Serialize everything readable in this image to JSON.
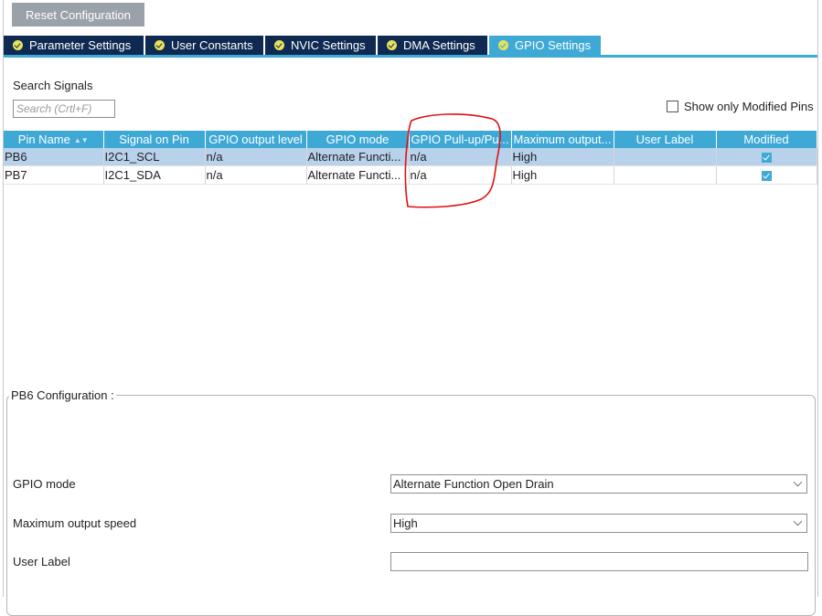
{
  "toolbar": {
    "reset_label": "Reset Configuration"
  },
  "tabs": [
    {
      "label": "Parameter Settings",
      "active": false
    },
    {
      "label": "User Constants",
      "active": false
    },
    {
      "label": "NVIC Settings",
      "active": false
    },
    {
      "label": "DMA Settings",
      "active": false
    },
    {
      "label": "GPIO Settings",
      "active": true
    }
  ],
  "search": {
    "label": "Search Signals",
    "placeholder": "Search (Crtl+F)"
  },
  "show_modified": {
    "label": "Show only Modified Pins",
    "checked": false
  },
  "table": {
    "columns": [
      "Pin Name",
      "Signal on Pin",
      "GPIO output level",
      "GPIO mode",
      "GPIO Pull-up/Pu...",
      "Maximum output...",
      "User Label",
      "Modified"
    ],
    "rows": [
      {
        "pin": "PB6",
        "signal": "I2C1_SCL",
        "output_level": "n/a",
        "mode": "Alternate Functi...",
        "pull": "n/a",
        "speed": "High",
        "user_label": "",
        "modified": true,
        "selected": true
      },
      {
        "pin": "PB7",
        "signal": "I2C1_SDA",
        "output_level": "n/a",
        "mode": "Alternate Functi...",
        "pull": "n/a",
        "speed": "High",
        "user_label": "",
        "modified": true,
        "selected": false
      }
    ]
  },
  "config": {
    "title": "PB6 Configuration :",
    "gpio_mode_label": "GPIO mode",
    "gpio_mode_value": "Alternate Function Open Drain",
    "speed_label": "Maximum output speed",
    "speed_value": "High",
    "user_label_label": "User Label",
    "user_label_value": ""
  },
  "colors": {
    "tab_bg": "#0f2a52",
    "tab_active": "#3fa9d6",
    "header_bg": "#3fa9d6",
    "selected_row": "#b9d2ec",
    "annotation": "#e01010"
  }
}
